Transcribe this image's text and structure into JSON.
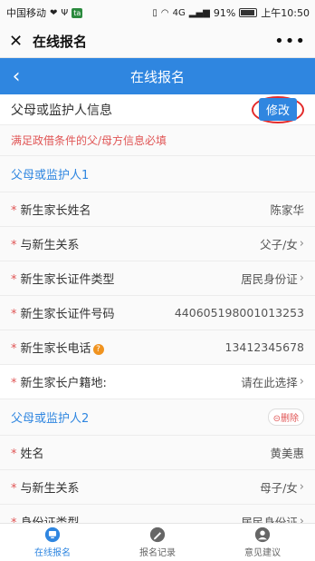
{
  "status_bar": {
    "carrier": "中国移动",
    "signal": "4G",
    "battery": "91%",
    "time": "上午10:50"
  },
  "wechat_header": {
    "title": "在线报名"
  },
  "page_header": {
    "title": "在线报名"
  },
  "section": {
    "title": "父母或监护人信息",
    "edit_label": "修改",
    "notice": "满足政借条件的父/母方信息必填"
  },
  "guardian1": {
    "label": "父母或监护人1",
    "rows": [
      {
        "label": "新生家长姓名",
        "value": "陈家华"
      },
      {
        "label": "与新生关系",
        "value": "父子/女"
      },
      {
        "label": "新生家长证件类型",
        "value": "居民身份证"
      },
      {
        "label": "新生家长证件号码",
        "value": "440605198001013253"
      },
      {
        "label": "新生家长电话",
        "value": "13412345678"
      },
      {
        "label": "新生家长户籍地:",
        "value": "请在此选择"
      }
    ]
  },
  "guardian2": {
    "label": "父母或监护人2",
    "delete_label": "删除",
    "rows": [
      {
        "label": "姓名",
        "value": "黄美惠"
      },
      {
        "label": "与新生关系",
        "value": "母子/女"
      },
      {
        "label": "身份证类型",
        "value": "居民身份证"
      }
    ]
  },
  "tabbar": {
    "items": [
      {
        "label": "在线报名",
        "icon": "monitor-icon",
        "active": true
      },
      {
        "label": "报名记录",
        "icon": "pen-icon",
        "active": false
      },
      {
        "label": "意见建议",
        "icon": "user-icon",
        "active": false
      }
    ]
  },
  "colors": {
    "primary": "#2f86e0",
    "required": "#e05555",
    "highlight_circle": "#e32b2b"
  }
}
